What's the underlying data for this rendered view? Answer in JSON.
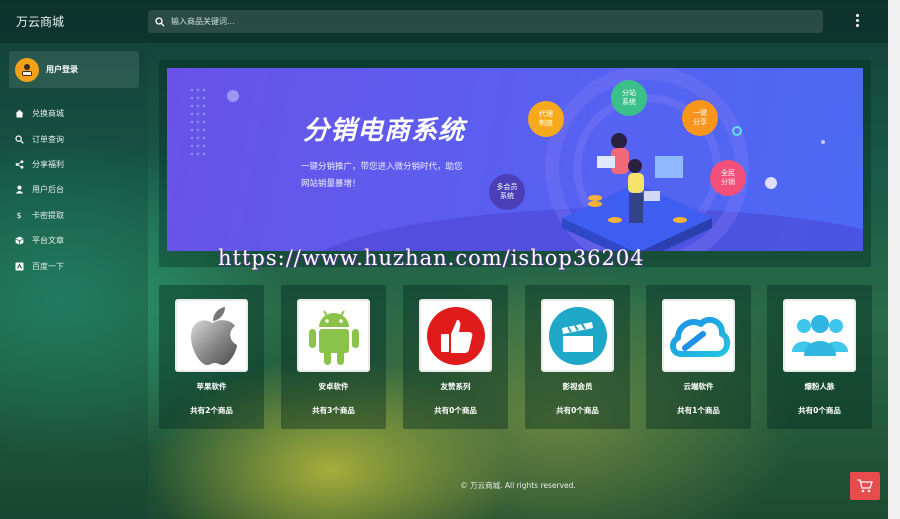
{
  "header": {
    "logo": "万云商城",
    "search_placeholder": "输入商品关键词...",
    "icons": {
      "search": "search-icon",
      "more": "more-vertical-icon"
    }
  },
  "sidebar": {
    "user_label": "用户登录",
    "items": [
      {
        "label": "兑换商城",
        "icon": "home-icon"
      },
      {
        "label": "订单查询",
        "icon": "search-icon"
      },
      {
        "label": "分享福利",
        "icon": "share-icon"
      },
      {
        "label": "用户后台",
        "icon": "user-icon"
      },
      {
        "label": "卡密提取",
        "icon": "dollar-icon"
      },
      {
        "label": "平台文章",
        "icon": "box-icon"
      },
      {
        "label": "百度一下",
        "icon": "baidu-icon"
      }
    ]
  },
  "banner": {
    "title": "分销电商系统",
    "subtitle_line1": "一键分销推广，带您进入微分销时代，助您",
    "subtitle_line2": "网站销量暴增！",
    "bubbles": {
      "agent": "代理\n制度",
      "tier": "分站\n系统",
      "share": "一键\n分享",
      "all": "全民\n分销",
      "member": "多会员\n系统"
    }
  },
  "watermark": "https://www.huzhan.com/ishop36204",
  "categories": [
    {
      "name": "苹果软件",
      "count": "共有2个商品",
      "icon": "apple-icon"
    },
    {
      "name": "安卓软件",
      "count": "共有3个商品",
      "icon": "android-icon"
    },
    {
      "name": "友赞系列",
      "count": "共有0个商品",
      "icon": "thumbs-up-icon"
    },
    {
      "name": "影视会员",
      "count": "共有0个商品",
      "icon": "clapperboard-icon"
    },
    {
      "name": "云端软件",
      "count": "共有1个商品",
      "icon": "cloud-icon"
    },
    {
      "name": "爆粉人脉",
      "count": "共有0个商品",
      "icon": "people-icon"
    }
  ],
  "footer": "© 万云商城. All rights reserved.",
  "colors": {
    "accent": "#e84b4b",
    "avatar": "#f2a21a",
    "banner": "#5b5ef0"
  }
}
